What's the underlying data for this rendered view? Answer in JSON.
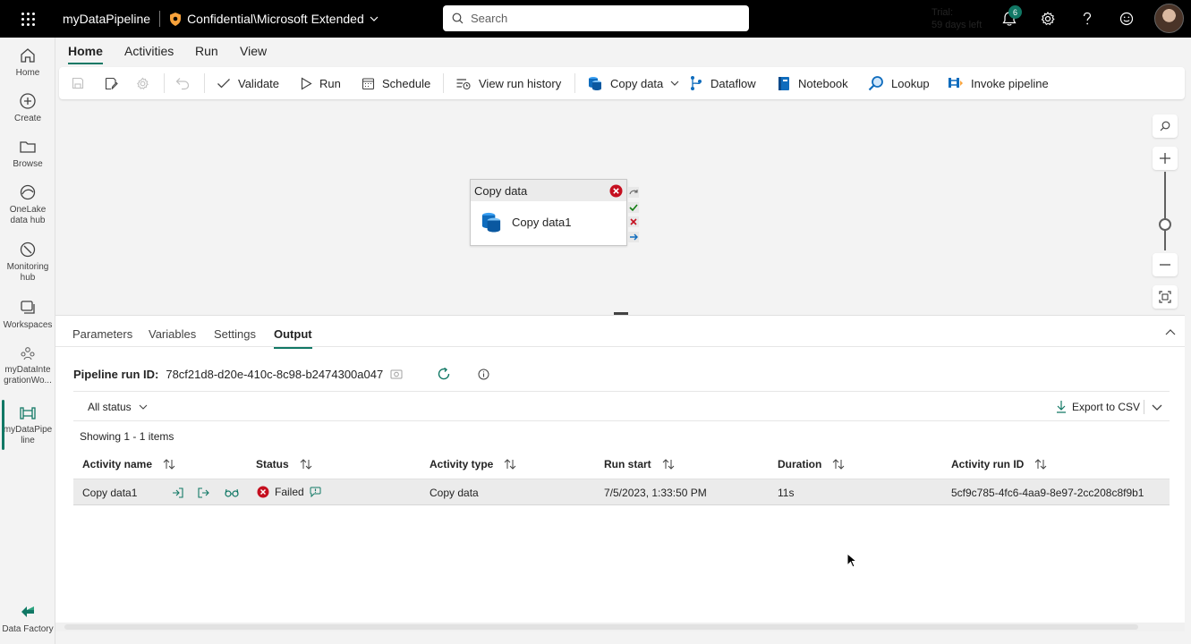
{
  "topbar": {
    "app_title": "myDataPipeline",
    "sensitivity_label": "Confidential\\Microsoft Extended",
    "search_placeholder": "Search",
    "trial_line1": "Trial:",
    "trial_line2": "59 days left",
    "notification_count": "6"
  },
  "rail": {
    "home": "Home",
    "create": "Create",
    "browse": "Browse",
    "onelake_1": "OneLake",
    "onelake_2": "data hub",
    "monitoring_1": "Monitoring",
    "monitoring_2": "hub",
    "workspaces": "Workspaces",
    "workspace_1": "myDataInte",
    "workspace_2": "grationWo...",
    "pipeline_1": "myDataPipe",
    "pipeline_2": "line",
    "data_factory": "Data Factory"
  },
  "ribbon_tabs": [
    "Home",
    "Activities",
    "Run",
    "View"
  ],
  "toolbar": {
    "validate": "Validate",
    "run": "Run",
    "schedule": "Schedule",
    "view_run_history": "View run history",
    "copy_data": "Copy data",
    "dataflow": "Dataflow",
    "notebook": "Notebook",
    "lookup": "Lookup",
    "invoke_pipeline": "Invoke pipeline"
  },
  "canvas": {
    "activity_type": "Copy data",
    "activity_name": "Copy data1"
  },
  "panel": {
    "tabs": [
      "Parameters",
      "Variables",
      "Settings",
      "Output"
    ],
    "run_id_label": "Pipeline run ID:",
    "run_id_value": "78cf21d8-d20e-410c-8c98-b2474300a047",
    "status_filter": "All status",
    "export": "Export to CSV",
    "showing": "Showing 1 - 1 items",
    "columns": [
      "Activity name",
      "Status",
      "Activity type",
      "Run start",
      "Duration",
      "Activity run ID"
    ],
    "rows": [
      {
        "activity_name": "Copy data1",
        "status": "Failed",
        "activity_type": "Copy data",
        "run_start": "7/5/2023, 1:33:50 PM",
        "duration": "11s",
        "activity_run_id": "5cf9c785-4fc6-4aa9-8e97-2cc208c8f9b1"
      }
    ]
  },
  "colors": {
    "accent": "#117865",
    "error": "#c50f1f",
    "success": "#107c10",
    "copy_blue": "#0f6cbd"
  }
}
